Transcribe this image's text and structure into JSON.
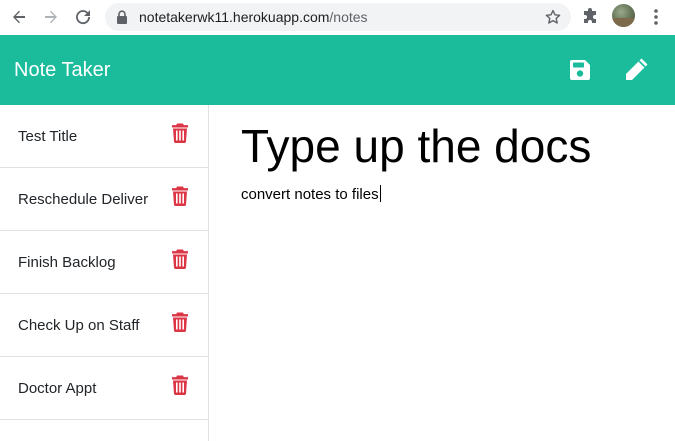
{
  "browser": {
    "url_host": "notetakerwk11.herokuapp.com",
    "url_path": "/notes"
  },
  "navbar": {
    "brand": "Note Taker",
    "brand_color": "#1abc9c",
    "save_icon": "save-icon",
    "new_note_icon": "pencil-icon"
  },
  "notes": [
    {
      "title": "Test Title"
    },
    {
      "title": "Reschedule Deliver"
    },
    {
      "title": "Finish Backlog"
    },
    {
      "title": "Check Up on Staff"
    },
    {
      "title": "Doctor Appt"
    }
  ],
  "delete_icon_color": "#dc3545",
  "active_note": {
    "title": "Type up the docs",
    "text": "convert notes to files"
  }
}
